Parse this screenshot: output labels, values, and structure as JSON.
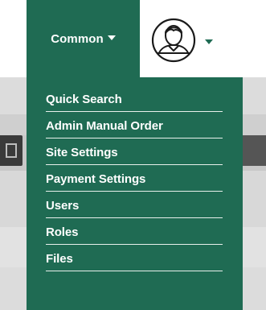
{
  "nav": {
    "common_label": "Common"
  },
  "avatar": {
    "icon": "user-avatar-icon"
  },
  "menu": {
    "items": [
      {
        "label": "Quick Search"
      },
      {
        "label": "Admin Manual Order"
      },
      {
        "label": "Site Settings"
      },
      {
        "label": "Payment Settings"
      },
      {
        "label": "Users"
      },
      {
        "label": "Roles"
      },
      {
        "label": "Files"
      }
    ]
  },
  "colors": {
    "brand_green": "#1f6b53",
    "menu_text": "#ffffff",
    "divider": "#e8f0ec"
  }
}
